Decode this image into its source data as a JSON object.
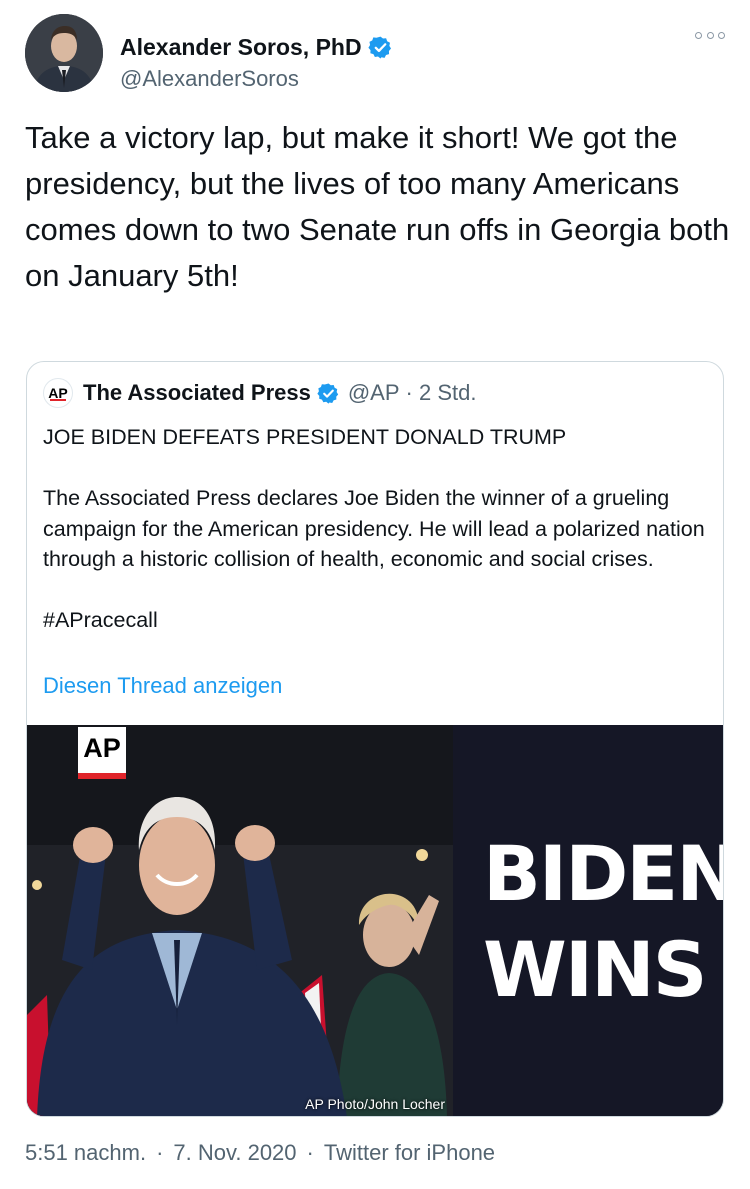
{
  "author": {
    "name": "Alexander Soros, PhD",
    "handle": "@AlexanderSoros",
    "verified": true
  },
  "tweet": {
    "text": "Take a victory lap, but make it short! We got the presidency, but the lives of too many Americans comes down to two Senate run offs in Georgia both on January 5th!"
  },
  "quote": {
    "logo_text": "AP",
    "name": "The Associated Press",
    "verified": true,
    "handle": "@AP",
    "time": "· 2 Std.",
    "headline": "JOE BIDEN DEFEATS PRESIDENT DONALD TRUMP",
    "body": "The Associated Press declares Joe Biden the winner of a grueling campaign for the American presidency. He will lead a polarized nation through a historic collision of health, economic and social crises.",
    "hashtag": "#APracecall",
    "thread_link": "Diesen Thread anzeigen",
    "image": {
      "ap_badge": "AP",
      "line1": "BIDEN",
      "line2": "WINS",
      "credit": "AP Photo/John Locher"
    }
  },
  "footer": {
    "time": "5:51 nachm.",
    "date": "7. Nov. 2020",
    "source": "Twitter for iPhone"
  },
  "colors": {
    "verified": "#1d9bf0",
    "link": "#1d9bf0",
    "secondary_text": "#536471",
    "image_panel": "#151726",
    "ap_red": "#e0242a"
  }
}
